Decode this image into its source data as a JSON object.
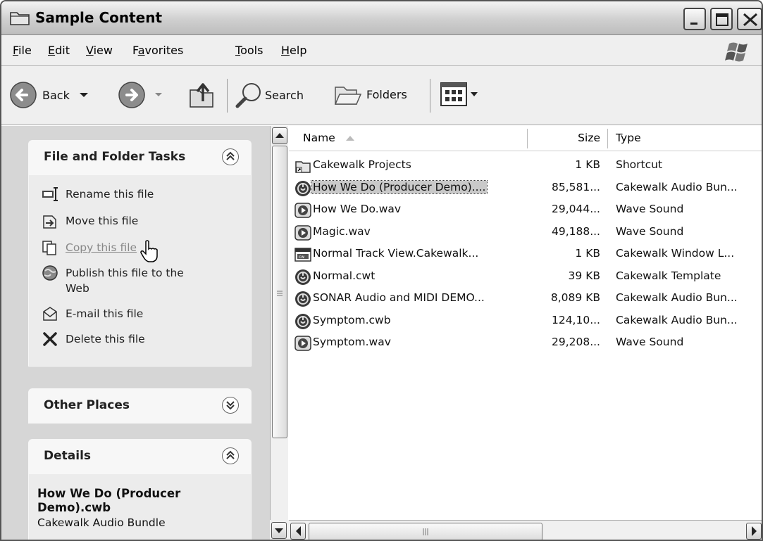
{
  "window": {
    "title": "Sample Content"
  },
  "menu": [
    {
      "label": "File",
      "u": "F",
      "rest": "ile"
    },
    {
      "label": "Edit",
      "u": "E",
      "rest": "dit"
    },
    {
      "label": "View",
      "u": "V",
      "rest": "iew"
    },
    {
      "label": "Favorites",
      "pre": "F",
      "u": "a",
      "rest": "vorites"
    },
    {
      "label": "Tools",
      "u": "T",
      "rest": "ools"
    },
    {
      "label": "Help",
      "u": "H",
      "rest": "elp"
    }
  ],
  "toolbar": {
    "back": "Back",
    "search": "Search",
    "folders": "Folders"
  },
  "tasks_panel": {
    "title": "File and Folder Tasks",
    "items": [
      "Rename this file",
      "Move this file",
      "Copy this file",
      "Publish this file to the",
      "Web",
      "E-mail this file",
      "Delete this file"
    ]
  },
  "other_places": {
    "title": "Other Places"
  },
  "details": {
    "title": "Details",
    "name_line1": "How We Do (Producer",
    "name_line2": "Demo).cwb",
    "type": "Cakewalk Audio Bundle"
  },
  "columns": {
    "name": "Name",
    "size": "Size",
    "type": "Type"
  },
  "files": [
    {
      "name": "Cakewalk Projects",
      "size": "1 KB",
      "type": "Shortcut",
      "icon": "folder-shortcut-icon"
    },
    {
      "name": "How We Do (Producer Demo)....",
      "size": "85,581...",
      "type": "Cakewalk Audio Bun...",
      "icon": "cakewalk-icon"
    },
    {
      "name": "How We Do.wav",
      "size": "29,044...",
      "type": "Wave Sound",
      "icon": "wave-icon"
    },
    {
      "name": "Magic.wav",
      "size": "49,188...",
      "type": "Wave Sound",
      "icon": "wave-icon"
    },
    {
      "name": "Normal Track View.Cakewalk...",
      "size": "1 KB",
      "type": "Cakewalk Window L...",
      "icon": "window-layout-icon"
    },
    {
      "name": "Normal.cwt",
      "size": "39 KB",
      "type": "Cakewalk Template",
      "icon": "cakewalk-icon"
    },
    {
      "name": "SONAR Audio and MIDI DEMO...",
      "size": "8,089 KB",
      "type": "Cakewalk Audio Bun...",
      "icon": "cakewalk-icon"
    },
    {
      "name": "Symptom.cwb",
      "size": "124,10...",
      "type": "Cakewalk Audio Bun...",
      "icon": "cakewalk-icon"
    },
    {
      "name": "Symptom.wav",
      "size": "29,208...",
      "type": "Wave Sound",
      "icon": "wave-icon"
    }
  ],
  "selected_index": 1
}
